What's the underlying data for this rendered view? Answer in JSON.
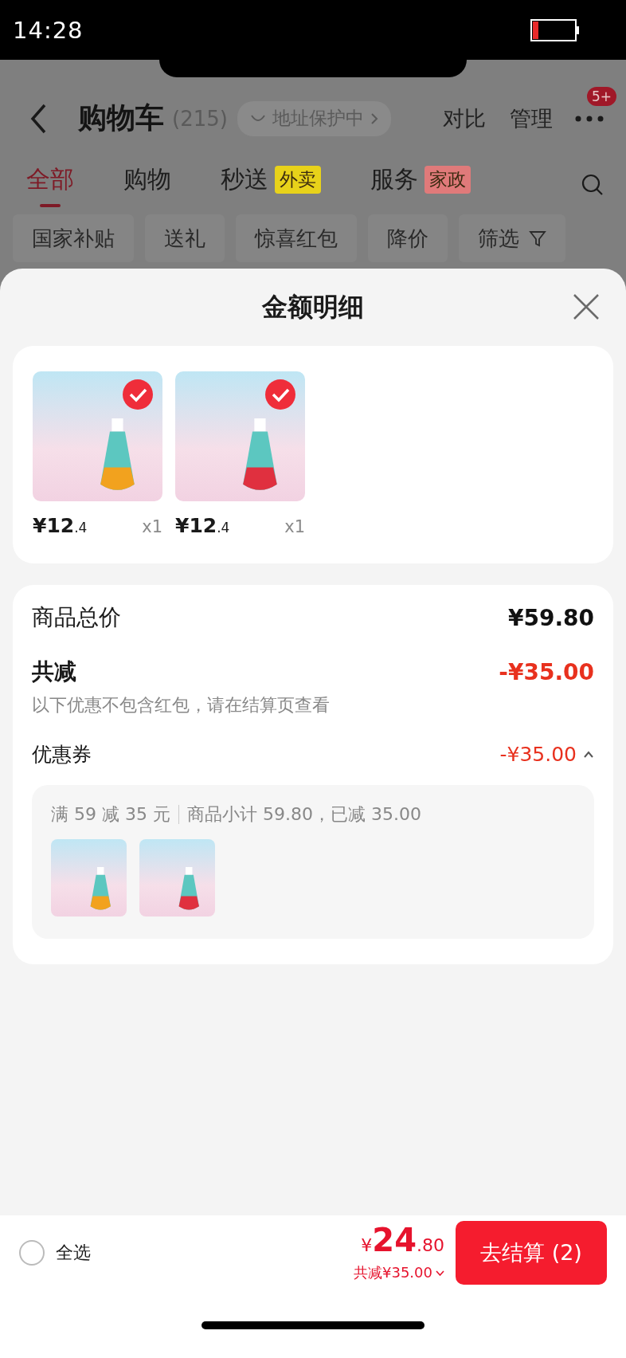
{
  "status_bar": {
    "time": "14:28"
  },
  "header": {
    "title": "购物车",
    "count": "(215)",
    "address_tag": "地址保护中",
    "actions": [
      "对比",
      "管理"
    ],
    "more_badge": "5+"
  },
  "tabs": [
    {
      "label": "全部",
      "selected": true
    },
    {
      "label": "购物",
      "selected": false
    },
    {
      "label": "秒送",
      "tag": "外卖",
      "color": "#e8d21a",
      "selected": false
    },
    {
      "label": "服务",
      "tag": "家政",
      "color": "#e07a7a",
      "selected": false
    }
  ],
  "filters": [
    {
      "label": "国家补贴",
      "kind": "chip"
    },
    {
      "label": "送礼",
      "kind": "chip"
    },
    {
      "label": "惊喜红包",
      "kind": "chip"
    },
    {
      "label": "降价",
      "kind": "chip"
    },
    {
      "label": "筛选",
      "kind": "filter"
    }
  ],
  "sheet": {
    "title": "金额明细",
    "items": [
      {
        "price": "¥12",
        "price_decimal": ".4",
        "quantity": "x1",
        "selected": true,
        "color": "#f2a21e"
      },
      {
        "price": "¥12",
        "price_decimal": ".4",
        "quantity": "x1",
        "selected": true,
        "color": "#e0303f"
      }
    ],
    "total": {
      "label": "商品总价",
      "amount": "¥59.80"
    },
    "discount": {
      "label": "共减",
      "amount": "-¥35.00",
      "note": "以下优惠不包含红包，请在结算页查看"
    },
    "coupon": {
      "label": "优惠券",
      "amount": "-¥35.00",
      "expanded": true,
      "rule": "满 59 减 35 元",
      "detail": "商品小计 59.80，已减 35.00"
    }
  },
  "bottom_bar": {
    "select_all": {
      "label": "全选",
      "checked": false
    },
    "currency": "¥",
    "amount": "24",
    "amount_decimal": ".80",
    "saved": "共减¥35.00",
    "checkout": "去结算 (2)"
  }
}
